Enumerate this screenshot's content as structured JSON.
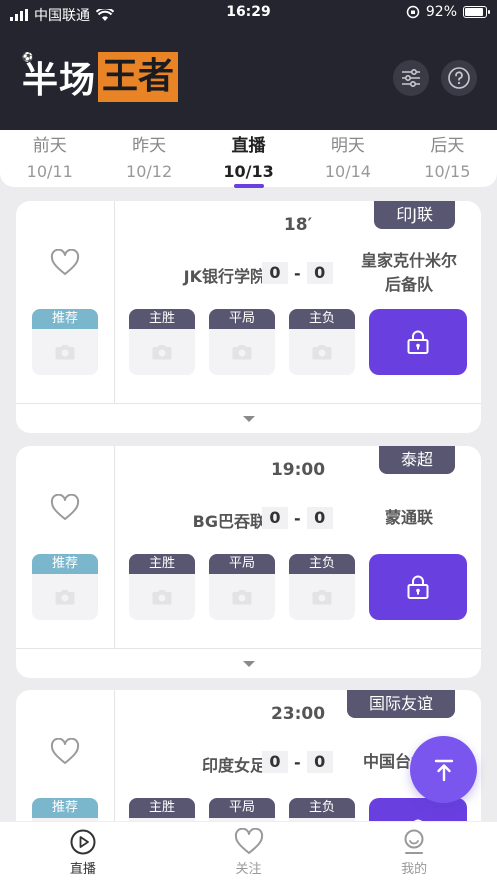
{
  "status_bar": {
    "carrier": "中国联通",
    "time": "16:29",
    "battery": "92%"
  },
  "header": {
    "logo_part1": "半场",
    "logo_part2": "王者"
  },
  "date_tabs": [
    {
      "label": "前天",
      "date": "10/11",
      "active": false
    },
    {
      "label": "昨天",
      "date": "10/12",
      "active": false
    },
    {
      "label": "直播",
      "date": "10/13",
      "active": true
    },
    {
      "label": "明天",
      "date": "10/14",
      "active": false
    },
    {
      "label": "后天",
      "date": "10/15",
      "active": false
    }
  ],
  "recommend_label": "推荐",
  "odds_labels": [
    "主胜",
    "平局",
    "主负"
  ],
  "matches": [
    {
      "league": "印J联",
      "time": "18′",
      "home": "JK银行学院",
      "home_score": "0",
      "sep": "-",
      "away_score": "0",
      "away_line1": "皇家克什米尔",
      "away_line2": "后备队"
    },
    {
      "league": "泰超",
      "time": "19:00",
      "home": "BG巴吞联",
      "home_score": "0",
      "sep": "-",
      "away_score": "0",
      "away_line1": "蒙通联",
      "away_line2": ""
    },
    {
      "league": "国际友谊",
      "time": "23:00",
      "home": "印度女足",
      "home_score": "0",
      "sep": "-",
      "away_score": "0",
      "away_line1": "中国台北",
      "away_line2": ""
    }
  ],
  "bottom_nav": [
    {
      "label": "直播",
      "icon": "play-icon",
      "active": true
    },
    {
      "label": "关注",
      "icon": "heart-icon",
      "active": false
    },
    {
      "label": "我的",
      "icon": "user-icon",
      "active": false
    }
  ],
  "colors": {
    "accent": "#6a3fe0",
    "header_bg": "#25252f",
    "logo_orange": "#e88426",
    "league_bg": "#585670",
    "recommend_bg": "#7ab6cc"
  }
}
